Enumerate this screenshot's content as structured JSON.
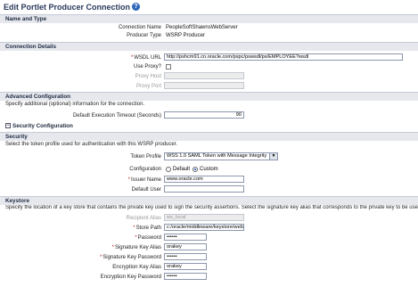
{
  "page": {
    "title": "Edit Portlet Producer Connection",
    "help_icon": "?"
  },
  "name_type": {
    "section": "Name and Type",
    "connection_name_label": "Connection Name",
    "connection_name_value": "PeopleSoftShawnsWebServer",
    "producer_type_label": "Producer Type",
    "producer_type_value": "WSRP Producer"
  },
  "connection_details": {
    "section": "Connection Details",
    "wsdl_label": "WSDL URL",
    "wsdl_value": "http://pshcm91.cn.oracle.com/pspc/pswsdl/ps/EMPLOYEE?wsdl",
    "use_proxy_label": "Use Proxy?",
    "proxy_host_label": "Proxy Host",
    "proxy_port_label": "Proxy Port"
  },
  "advanced": {
    "section": "Advanced Configuration",
    "description": "Specify additional (optional) information for the connection.",
    "timeout_label": "Default Execution Timeout (Seconds)",
    "timeout_value": "90"
  },
  "security_config": {
    "toggle_label": "Security Configuration",
    "section": "Security",
    "description": "Select the token profile used for authentication with this WSRP producer.",
    "token_profile_label": "Token Profile",
    "token_profile_value": "WSS 1.0 SAML Token with Message Integrity",
    "configuration_label": "Configuration",
    "radio_default": "Default",
    "radio_custom": "Custom",
    "issuer_name_label": "Issuer Name",
    "issuer_name_value": "www.oracle.com",
    "default_user_label": "Default User",
    "default_user_value": ""
  },
  "keystore": {
    "section": "Keystore",
    "description": "Specify the location of a key store that contains the private key used to sign the security assertions. Select the signature key alias that corresponds to the private key to be used for signing",
    "recipient_alias_label": "Recipient Alias",
    "recipient_alias_value": "ws_local",
    "store_path_label": "Store Path",
    "store_path_value": "c:/oracle/middleware/keystore/web",
    "password_label": "Password",
    "password_value": "••••••",
    "signature_alias_label": "Signature Key Alias",
    "signature_alias_value": "orakey",
    "signature_password_label": "Signature Key Password",
    "signature_password_value": "••••••",
    "encryption_alias_label": "Encryption Key Alias",
    "encryption_alias_value": "orakey",
    "encryption_password_label": "Encryption Key Password",
    "encryption_password_value": "••••••"
  },
  "colors": {
    "accent": "#2c66b8",
    "section_bg": "#e6e8ee",
    "title": "#2a3a5c",
    "required": "#bf2a2a"
  }
}
